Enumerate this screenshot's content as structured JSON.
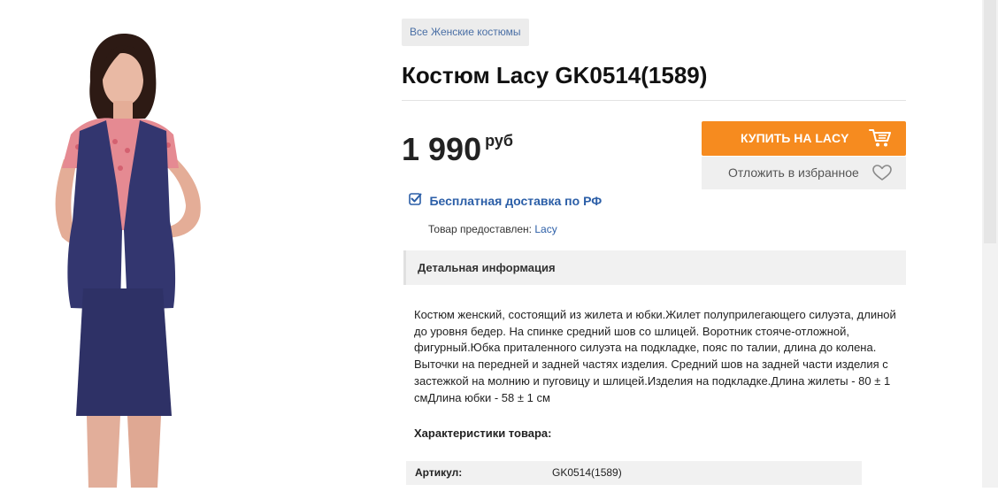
{
  "breadcrumb": {
    "category": "Все Женские костюмы"
  },
  "product": {
    "title": "Костюм Lacy GK0514(1589)",
    "price": "1 990",
    "currency": "руб"
  },
  "actions": {
    "buy_label": "КУПИТЬ НА LACY",
    "favorite_label": "Отложить в избранное"
  },
  "delivery": {
    "label": "Бесплатная доставка по РФ"
  },
  "supplier": {
    "prefix": "Товар предоставлен: ",
    "name": "Lacy"
  },
  "details": {
    "tab_label": "Детальная информация",
    "description": "Костюм женский, состоящий из жилета и юбки.Жилет полуприлегающего силуэта, длиной до уровня бедер. На спинке средний шов со шлицей. Воротник стояче-отложной, фигурный.Юбка приталенного силуэта на подкладке, пояс по талии, длина до колена. Выточки на передней и задней частях изделия. Средний шов на задней части изделия с застежкой на молнию и пуговицу и шлицей.Изделия на подкладке.Длина жилеты - 80 ± 1 смДлина юбки - 58 ± 1 см"
  },
  "specs": {
    "heading": "Характеристики товара:",
    "rows": [
      {
        "key": "Артикул:",
        "value": "GK0514(1589)"
      }
    ]
  },
  "icons": {
    "cart": "shopping-cart-icon",
    "favorite": "heart-outline-icon",
    "delivery": "checkbox-checked-icon"
  },
  "colors": {
    "buy_button": "#f68b1f",
    "link": "#2b5ea7",
    "vest": "#33366f",
    "blouse": "#e58a92"
  }
}
